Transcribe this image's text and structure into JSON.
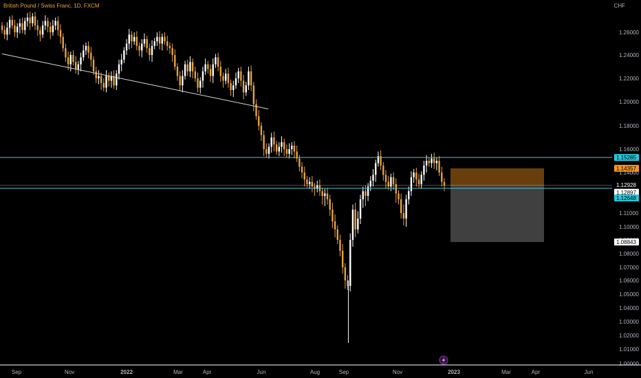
{
  "header": {
    "title": "British Pound / Swiss Franc, 1D, FXCM",
    "currency": "CHF"
  },
  "colors": {
    "background": "#000000",
    "candle": "#e8a33d",
    "candle_up": "#ffffff",
    "level_line": "#4fc3d6",
    "trend_line": "#d8d8d8",
    "target_zone": "#7a4a0e",
    "stop_zone": "#555555",
    "tag_orange": "#f7941d",
    "tag_cyan": "#26c6da",
    "tag_white": "#ffffff",
    "axis_text": "#b2b5be"
  },
  "icons": {
    "event_marker": "lightning-icon"
  },
  "chart_data": {
    "type": "candlestick",
    "symbol": "British Pound / Swiss Franc",
    "interval": "1D",
    "source": "FXCM",
    "currency": "CHF",
    "ylim": [
      1.0,
      1.275
    ],
    "price_ticks": [
      "1.26000",
      "1.24000",
      "1.22000",
      "1.20000",
      "1.18000",
      "1.16000",
      "1.14000",
      "1.12000",
      "1.11000",
      "1.10000",
      "1.09000",
      "1.08000",
      "1.07000",
      "1.06000",
      "1.05000",
      "1.04000",
      "1.03000",
      "1.02000",
      "1.01000",
      "1.00000"
    ],
    "time_ticks": [
      "Sep",
      "Nov",
      "2022",
      "Mar",
      "Apr",
      "Jun",
      "Aug",
      "Sep",
      "Nov",
      "2023",
      "Mar",
      "Apr",
      "Jun"
    ],
    "series_close": [
      1.262,
      1.258,
      1.264,
      1.271,
      1.266,
      1.26,
      1.265,
      1.268,
      1.262,
      1.27,
      1.273,
      1.268,
      1.274,
      1.266,
      1.262,
      1.258,
      1.266,
      1.27,
      1.265,
      1.26,
      1.266,
      1.27,
      1.262,
      1.256,
      1.246,
      1.238,
      1.232,
      1.24,
      1.234,
      1.228,
      1.232,
      1.238,
      1.244,
      1.248,
      1.242,
      1.236,
      1.226,
      1.22,
      1.222,
      1.216,
      1.212,
      1.222,
      1.218,
      1.222,
      1.214,
      1.224,
      1.232,
      1.236,
      1.244,
      1.25,
      1.258,
      1.252,
      1.256,
      1.248,
      1.244,
      1.25,
      1.254,
      1.246,
      1.24,
      1.248,
      1.252,
      1.256,
      1.25,
      1.256,
      1.252,
      1.248,
      1.246,
      1.24,
      1.23,
      1.222,
      1.214,
      1.222,
      1.232,
      1.226,
      1.234,
      1.226,
      1.22,
      1.212,
      1.218,
      1.226,
      1.232,
      1.228,
      1.222,
      1.232,
      1.238,
      1.23,
      1.222,
      1.218,
      1.224,
      1.216,
      1.21,
      1.214,
      1.22,
      1.226,
      1.218,
      1.208,
      1.214,
      1.226,
      1.214,
      1.198,
      1.188,
      1.18,
      1.172,
      1.16,
      1.156,
      1.162,
      1.17,
      1.164,
      1.158,
      1.162,
      1.166,
      1.16,
      1.156,
      1.16,
      1.163,
      1.158,
      1.152,
      1.145,
      1.14,
      1.134,
      1.13,
      1.132,
      1.128,
      1.126,
      1.129,
      1.124,
      1.12,
      1.122,
      1.118,
      1.112,
      1.104,
      1.098,
      1.09,
      1.082,
      1.07,
      1.06,
      1.056,
      1.09,
      1.112,
      1.098,
      1.106,
      1.118,
      1.124,
      1.12,
      1.128,
      1.133,
      1.138,
      1.148,
      1.154,
      1.146,
      1.138,
      1.132,
      1.128,
      1.136,
      1.13,
      1.122,
      1.118,
      1.11,
      1.106,
      1.118,
      1.124,
      1.136,
      1.14,
      1.134,
      1.13,
      1.138,
      1.146,
      1.15,
      1.148,
      1.152,
      1.148,
      1.15,
      1.14,
      1.132,
      1.129
    ],
    "levels": [
      {
        "name": "resistance",
        "price": 1.15285,
        "label": "1.15285"
      },
      {
        "name": "support",
        "price": 1.12648,
        "label": "1.12648"
      }
    ],
    "trend_line": {
      "from": {
        "bar": 0,
        "price": 1.241
      },
      "to": {
        "bar": 102,
        "price": 1.194
      }
    },
    "position": {
      "entry": 1.12897,
      "target": 1.14357,
      "stop": 1.08843,
      "labels": {
        "target": "1.14357",
        "entry": "1.12928",
        "current": "1.12897",
        "countdown": "22:09:10",
        "stop": "1.08843",
        "support": "1.12648"
      }
    }
  }
}
